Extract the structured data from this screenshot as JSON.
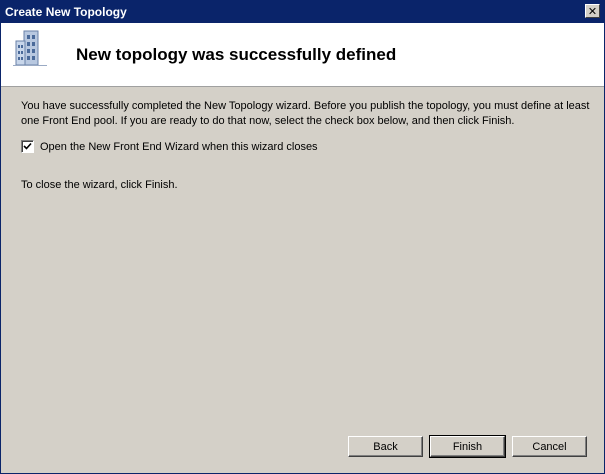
{
  "window": {
    "title": "Create New Topology",
    "close_glyph": "✕"
  },
  "header": {
    "icon": "building-icon",
    "title": "New topology was successfully defined"
  },
  "body": {
    "description": "You have successfully completed the New Topology wizard. Before you publish the topology, you must define at least one Front End pool. If you are ready to do that now, select the check box below, and then click Finish.",
    "checkbox": {
      "label": "Open the New Front End Wizard when this wizard closes",
      "checked": true
    },
    "finish_instruction": "To close the wizard, click Finish."
  },
  "buttons": {
    "back": "Back",
    "finish": "Finish",
    "cancel": "Cancel"
  },
  "colors": {
    "titlebar": "#0a246a",
    "window_face": "#d4d0c8",
    "header_bg": "#ffffff"
  }
}
